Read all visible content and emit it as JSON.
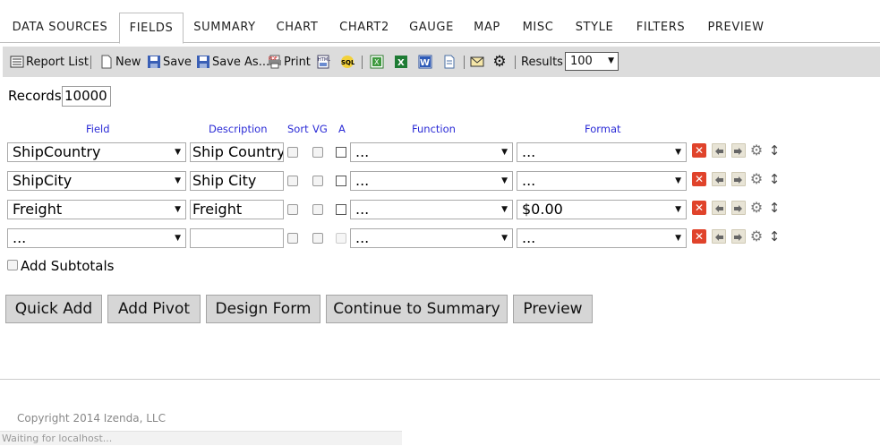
{
  "tabs": [
    "DATA SOURCES",
    "FIELDS",
    "SUMMARY",
    "CHART",
    "CHART2",
    "GAUGE",
    "MAP",
    "MISC",
    "STYLE",
    "FILTERS",
    "PREVIEW"
  ],
  "active_tab": "FIELDS",
  "toolbar": {
    "report_list": "Report List",
    "new": "New",
    "save": "Save",
    "save_as": "Save As...",
    "print": "Print",
    "results_label": "Results",
    "results_value": "100"
  },
  "records": {
    "label": "Records",
    "value": "10000"
  },
  "headers": {
    "field": "Field",
    "description": "Description",
    "sort": "Sort",
    "vg": "VG",
    "a": "A",
    "function": "Function",
    "format": "Format"
  },
  "rows": [
    {
      "field": "ShipCountry",
      "description": "Ship Country",
      "function": "...",
      "format": "..."
    },
    {
      "field": "ShipCity",
      "description": "Ship City",
      "function": "...",
      "format": "..."
    },
    {
      "field": "Freight",
      "description": "Freight",
      "function": "...",
      "format": "$0.00"
    },
    {
      "field": "...",
      "description": "",
      "function": "...",
      "format": "..."
    }
  ],
  "add_subtotals": "Add Subtotals",
  "buttons": {
    "quick_add": "Quick Add",
    "add_pivot": "Add Pivot",
    "design_form": "Design Form",
    "continue": "Continue to Summary",
    "preview": "Preview"
  },
  "footer": {
    "copyright": "Copyright 2014 Izenda, LLC",
    "status": "Waiting for localhost..."
  },
  "colors": {
    "link_blue": "#2a2ad6",
    "delete_red": "#e0432b",
    "toolbar_bg": "#dcdcdc",
    "button_bg": "#d6d6d6"
  },
  "icons": [
    "report-list-icon",
    "new-document-icon",
    "save-icon",
    "save-as-icon",
    "print-icon",
    "html-export-icon",
    "sql-icon",
    "excel-icon",
    "excel-export-icon",
    "word-icon",
    "document-icon",
    "email-icon",
    "gear-icon"
  ]
}
